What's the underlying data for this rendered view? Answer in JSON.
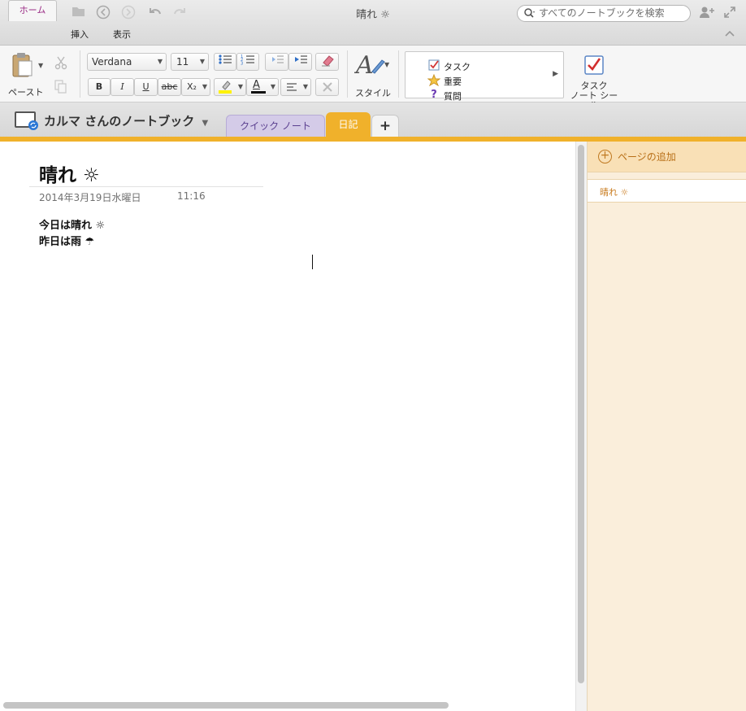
{
  "window": {
    "title": "晴れ ☼",
    "search_placeholder": "すべてのノートブックを検索"
  },
  "ribbon_tabs": [
    {
      "label": "ホーム",
      "active": true
    },
    {
      "label": "挿入",
      "active": false
    },
    {
      "label": "表示",
      "active": false
    }
  ],
  "ribbon": {
    "paste_label": "ペースト",
    "font_name": "Verdana",
    "font_size": "11",
    "bold": "B",
    "italic": "I",
    "underline": "U",
    "strike": "abc",
    "subscript": "X₂",
    "font_color_letter": "A",
    "style_label": "スタイル",
    "tags": [
      {
        "label": "タスク",
        "icon": "checkbox-icon"
      },
      {
        "label": "重要",
        "icon": "star-icon"
      },
      {
        "label": "質問",
        "icon": "question-icon"
      }
    ],
    "todo_tag_line1": "タスク",
    "todo_tag_line2": "ノート シール"
  },
  "notebook": {
    "title": "カルマ さんのノートブック",
    "sections": [
      {
        "label": "クイック ノート",
        "color": "#d4cbe8"
      },
      {
        "label": "日記",
        "color": "#f0b12b"
      }
    ],
    "add_section": "+"
  },
  "page": {
    "title": "晴れ ☼",
    "date": "2014年3月19日水曜日",
    "time": "11:16",
    "lines": [
      "今日は晴れ ☼",
      "昨日は雨 ☂"
    ]
  },
  "page_list": {
    "add_page_label": "ページの追加",
    "pages": [
      "晴れ ☼"
    ]
  },
  "colors": {
    "accent_orange": "#f0b12b",
    "active_tab_text": "#9b2d86",
    "page_list_bg": "#faeedb"
  }
}
